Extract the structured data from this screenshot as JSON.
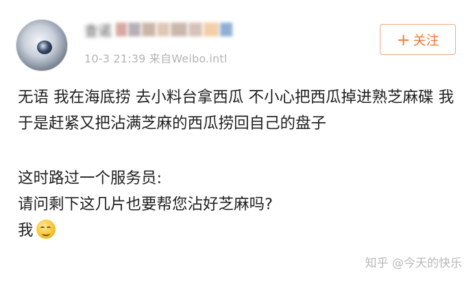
{
  "post": {
    "username": "查诺",
    "meta": "10-3 21:39  来自Weibo.intl",
    "follow_label": "关注",
    "paragraph1": "无语 我在海底捞 去小料台拿西瓜 不小心把西瓜掉进熟芝麻碟 我于是赶紧又把沾满芝麻的西瓜捞回自己的盘子",
    "line2": "这时路过一个服务员:",
    "line3": "请问剩下这几片也要帮您沾好芝麻吗?",
    "line4": "我"
  },
  "watermark": "知乎 @今天的快乐",
  "icons": {
    "follow": "plus-icon",
    "emoji": "grin-sweat-emoji"
  },
  "colors": {
    "accent": "#ec7c36",
    "meta_text": "#b4b4b4",
    "body_text": "#1f1f1f"
  }
}
